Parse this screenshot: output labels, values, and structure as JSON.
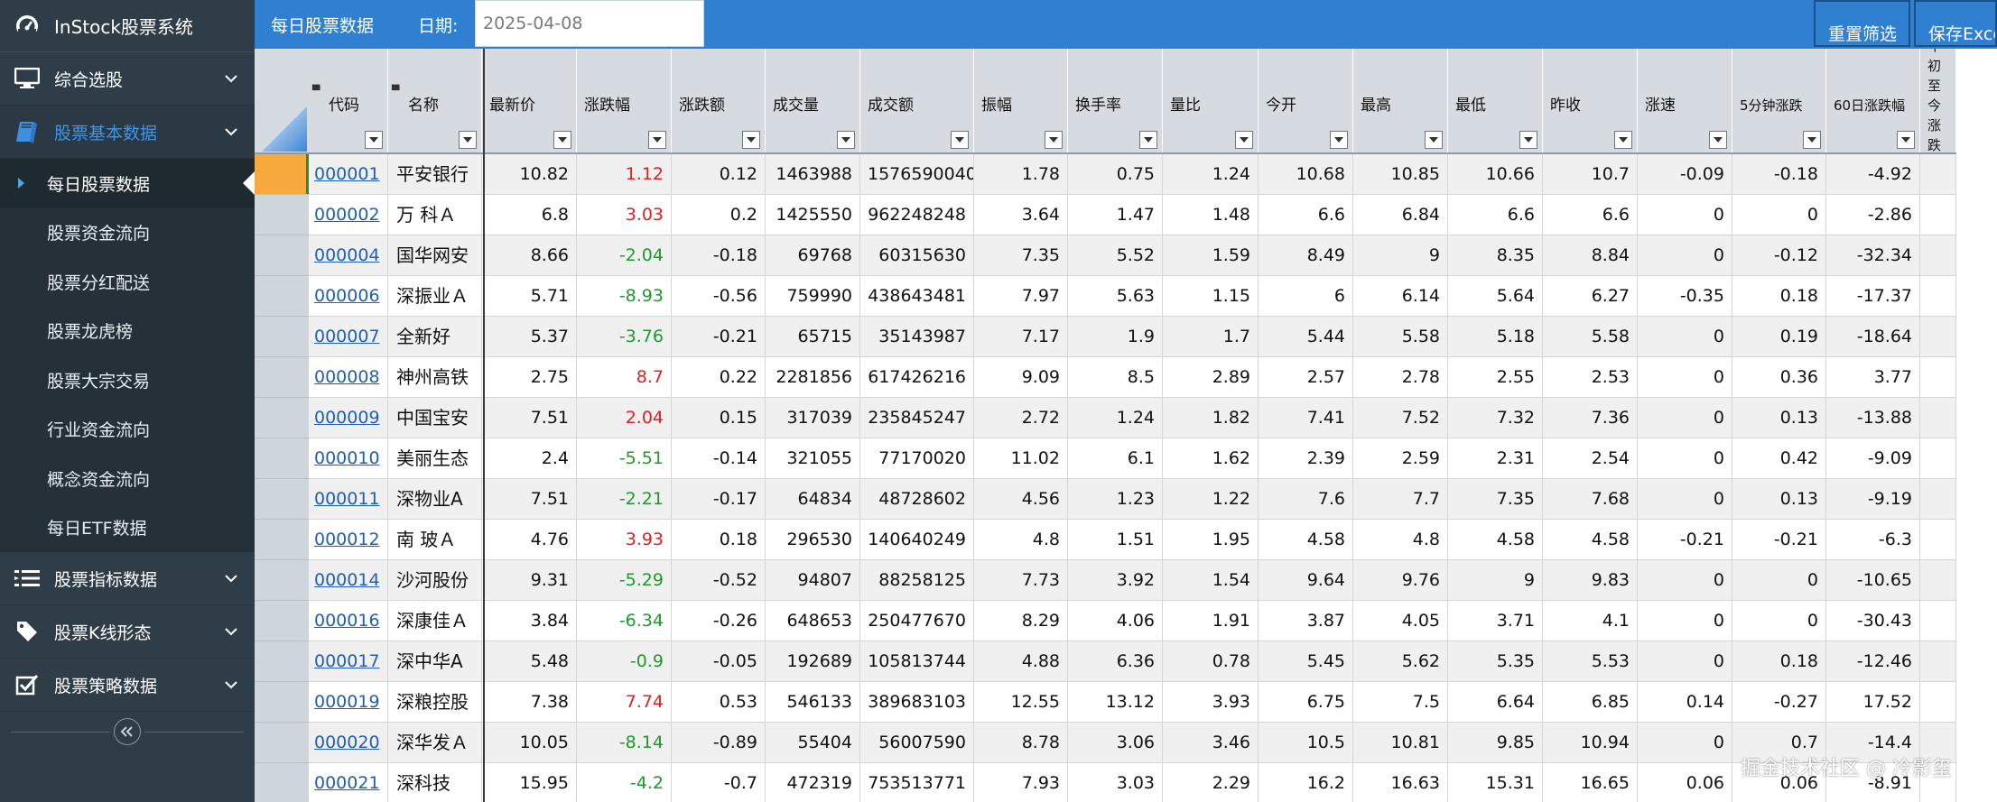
{
  "app": {
    "title": "InStock股票系统"
  },
  "sidebar": {
    "items": [
      {
        "label": "综合选股",
        "icon": "monitor-icon"
      },
      {
        "label": "股票基本数据",
        "icon": "book-icon",
        "children": [
          "每日股票数据",
          "股票资金流向",
          "股票分红配送",
          "股票龙虎榜",
          "股票大宗交易",
          "行业资金流向",
          "概念资金流向",
          "每日ETF数据"
        ]
      },
      {
        "label": "股票指标数据",
        "icon": "list-icon"
      },
      {
        "label": "股票K线形态",
        "icon": "tag-icon"
      },
      {
        "label": "股票策略数据",
        "icon": "checkbox-icon"
      }
    ]
  },
  "topbar": {
    "title": "每日股票数据",
    "date_label": "日期:",
    "date_value": "2025-04-08",
    "reset_label": "重置筛选",
    "save_label": "保存Excel"
  },
  "table": {
    "columns": [
      "代码",
      "名称",
      "最新价",
      "涨跌幅",
      "涨跌额",
      "成交量",
      "成交额",
      "振幅",
      "换手率",
      "量比",
      "今开",
      "最高",
      "最低",
      "昨收",
      "涨速",
      "5分钟涨跌",
      "60日涨跌幅",
      "年初至今涨跌幅"
    ],
    "rows": [
      [
        "000001",
        "平安银行",
        "10.82",
        "1.12",
        "0.12",
        "1463988",
        "1576590040",
        "1.78",
        "0.75",
        "1.24",
        "10.68",
        "10.85",
        "10.66",
        "10.7",
        "-0.09",
        "-0.18",
        "-4.92"
      ],
      [
        "000002",
        "万 科Ａ",
        "6.8",
        "3.03",
        "0.2",
        "1425550",
        "962248248",
        "3.64",
        "1.47",
        "1.48",
        "6.6",
        "6.84",
        "6.6",
        "6.6",
        "0",
        "0",
        "-2.86"
      ],
      [
        "000004",
        "国华网安",
        "8.66",
        "-2.04",
        "-0.18",
        "69768",
        "60315630",
        "7.35",
        "5.52",
        "1.59",
        "8.49",
        "9",
        "8.35",
        "8.84",
        "0",
        "-0.12",
        "-32.34"
      ],
      [
        "000006",
        "深振业Ａ",
        "5.71",
        "-8.93",
        "-0.56",
        "759990",
        "438643481",
        "7.97",
        "5.63",
        "1.15",
        "6",
        "6.14",
        "5.64",
        "6.27",
        "-0.35",
        "0.18",
        "-17.37"
      ],
      [
        "000007",
        "全新好",
        "5.37",
        "-3.76",
        "-0.21",
        "65715",
        "35143987",
        "7.17",
        "1.9",
        "1.7",
        "5.44",
        "5.58",
        "5.18",
        "5.58",
        "0",
        "0.19",
        "-18.64"
      ],
      [
        "000008",
        "神州高铁",
        "2.75",
        "8.7",
        "0.22",
        "2281856",
        "617426216",
        "9.09",
        "8.5",
        "2.89",
        "2.57",
        "2.78",
        "2.55",
        "2.53",
        "0",
        "0.36",
        "3.77"
      ],
      [
        "000009",
        "中国宝安",
        "7.51",
        "2.04",
        "0.15",
        "317039",
        "235845247",
        "2.72",
        "1.24",
        "1.82",
        "7.41",
        "7.52",
        "7.32",
        "7.36",
        "0",
        "0.13",
        "-13.88"
      ],
      [
        "000010",
        "美丽生态",
        "2.4",
        "-5.51",
        "-0.14",
        "321055",
        "77170020",
        "11.02",
        "6.1",
        "1.62",
        "2.39",
        "2.59",
        "2.31",
        "2.54",
        "0",
        "0.42",
        "-9.09"
      ],
      [
        "000011",
        "深物业A",
        "7.51",
        "-2.21",
        "-0.17",
        "64834",
        "48728602",
        "4.56",
        "1.23",
        "1.22",
        "7.6",
        "7.7",
        "7.35",
        "7.68",
        "0",
        "0.13",
        "-9.19"
      ],
      [
        "000012",
        "南 玻Ａ",
        "4.76",
        "3.93",
        "0.18",
        "296530",
        "140640249",
        "4.8",
        "1.51",
        "1.95",
        "4.58",
        "4.8",
        "4.58",
        "4.58",
        "-0.21",
        "-0.21",
        "-6.3"
      ],
      [
        "000014",
        "沙河股份",
        "9.31",
        "-5.29",
        "-0.52",
        "94807",
        "88258125",
        "7.73",
        "3.92",
        "1.54",
        "9.64",
        "9.76",
        "9",
        "9.83",
        "0",
        "0",
        "-10.65"
      ],
      [
        "000016",
        "深康佳Ａ",
        "3.84",
        "-6.34",
        "-0.26",
        "648653",
        "250477670",
        "8.29",
        "4.06",
        "1.91",
        "3.87",
        "4.05",
        "3.71",
        "4.1",
        "0",
        "0",
        "-30.43"
      ],
      [
        "000017",
        "深中华A",
        "5.48",
        "-0.9",
        "-0.05",
        "192689",
        "105813744",
        "4.88",
        "6.36",
        "0.78",
        "5.45",
        "5.62",
        "5.35",
        "5.53",
        "0",
        "0.18",
        "-12.46"
      ],
      [
        "000019",
        "深粮控股",
        "7.38",
        "7.74",
        "0.53",
        "546133",
        "389683103",
        "12.55",
        "13.12",
        "3.93",
        "6.75",
        "7.5",
        "6.64",
        "6.85",
        "0.14",
        "-0.27",
        "17.52"
      ],
      [
        "000020",
        "深华发Ａ",
        "10.05",
        "-8.14",
        "-0.89",
        "55404",
        "56007590",
        "8.78",
        "3.06",
        "3.46",
        "10.5",
        "10.81",
        "9.85",
        "10.94",
        "0",
        "0.7",
        "-14.4"
      ],
      [
        "000021",
        "深科技",
        "15.95",
        "-4.2",
        "-0.7",
        "472319",
        "753513771",
        "7.93",
        "3.03",
        "2.29",
        "16.2",
        "16.63",
        "15.31",
        "16.65",
        "0.06",
        "0.06",
        "-8.91"
      ]
    ]
  },
  "watermark": "掘金技术社区 @ 冷影玺",
  "colors": {
    "topbar": "#2f80d0",
    "sidebar": "#2f3d48",
    "up": "#e02020",
    "down": "#1d9a2b",
    "link": "#1f5fb5",
    "selected_row_marker": "#f7a93b"
  }
}
